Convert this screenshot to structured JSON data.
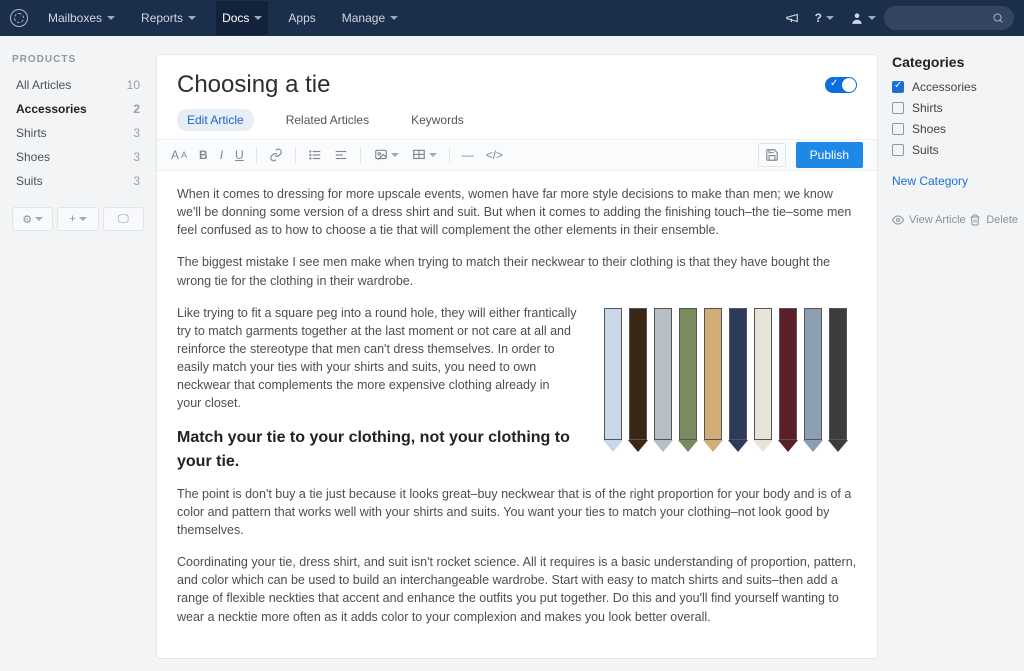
{
  "topnav": {
    "items": [
      {
        "label": "Mailboxes"
      },
      {
        "label": "Reports"
      },
      {
        "label": "Docs",
        "active": true
      },
      {
        "label": "Apps"
      },
      {
        "label": "Manage"
      }
    ]
  },
  "sidebar": {
    "heading": "PRODUCTS",
    "items": [
      {
        "label": "All Articles",
        "count": "10"
      },
      {
        "label": "Accessories",
        "count": "2",
        "active": true
      },
      {
        "label": "Shirts",
        "count": "3"
      },
      {
        "label": "Shoes",
        "count": "3"
      },
      {
        "label": "Suits",
        "count": "3"
      }
    ]
  },
  "article": {
    "title": "Choosing a tie",
    "tabs": [
      {
        "label": "Edit Article",
        "active": true
      },
      {
        "label": "Related Articles"
      },
      {
        "label": "Keywords"
      }
    ],
    "publish_label": "Publish",
    "body": {
      "p1": "When it comes to dressing for more upscale events, women have far more style decisions to make than men; we know we'll be donning some version of a dress shirt and suit. But when it comes to adding the finishing touch–the tie–some men feel confused as to how to choose a tie that will complement the other elements in their ensemble.",
      "p2": "The biggest mistake I see men make when trying to match their neckwear to their clothing is that they have bought the wrong tie for the clothing in their wardrobe.",
      "p3": "Like trying to fit a square peg into a round hole, they will either frantically try to match garments together at the last moment or not care at all and reinforce the stereotype that men can't dress themselves.  In order to easily match your ties with your shirts and suits, you need to own neckwear that complements the more expensive clothing already in your closet.",
      "h3": "Match your tie to your clothing, not your clothing to your tie.",
      "p4": "The point is don't buy a tie just because it looks great–buy neckwear that is of the right proportion for your body and is of a color and pattern that works well with your shirts and suits. You want your ties to match your clothing–not look good by themselves.",
      "p5": "Coordinating your tie, dress shirt, and suit isn't rocket science.  All it requires is a basic understanding of proportion, pattern, and color which can be used to build an interchangeable wardrobe.  Start with easy to match shirts and suits–then add a range of flexible neckties that accent and enhance the outfits you put together. Do this and you'll find yourself wanting to wear a necktie more often as it adds color to your complexion and makes you look better overall."
    },
    "tie_colors": [
      "#c9d8e8",
      "#3b2715",
      "#b7bfc5",
      "#7a8b5f",
      "#d1ae78",
      "#2e3a5a",
      "#e7e4d9",
      "#5a1f28",
      "#8c9fb3",
      "#3c3c3c"
    ]
  },
  "right": {
    "heading": "Categories",
    "cats": [
      {
        "label": "Accessories",
        "checked": true
      },
      {
        "label": "Shirts"
      },
      {
        "label": "Shoes"
      },
      {
        "label": "Suits"
      }
    ],
    "new_label": "New Category",
    "view_label": "View Article",
    "delete_label": "Delete"
  }
}
